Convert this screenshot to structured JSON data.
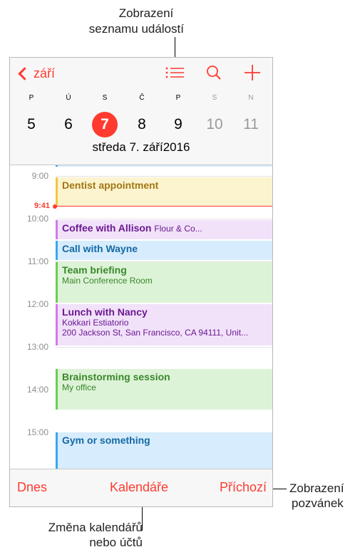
{
  "callouts": {
    "top_line1": "Zobrazení",
    "top_line2": "seznamu událostí",
    "right_line1": "Zobrazení",
    "right_line2": "pozvánek",
    "bottom_line1": "Změna kalendářů",
    "bottom_line2": "nebo účtů"
  },
  "header": {
    "back_label": "září",
    "icons": [
      "list-icon",
      "search-icon",
      "plus-icon"
    ],
    "date_label": "středa 7. září2016"
  },
  "week": {
    "days": [
      {
        "letter": "P",
        "number": "5",
        "weekend": false
      },
      {
        "letter": "Ú",
        "number": "6",
        "weekend": false
      },
      {
        "letter": "S",
        "number": "7",
        "weekend": false,
        "today": true
      },
      {
        "letter": "Č",
        "number": "8",
        "weekend": false
      },
      {
        "letter": "P",
        "number": "9",
        "weekend": false
      },
      {
        "letter": "S",
        "number": "10",
        "weekend": true
      },
      {
        "letter": "N",
        "number": "11",
        "weekend": true
      }
    ]
  },
  "timeline": {
    "hours": [
      "9:00",
      "10:00",
      "11:00",
      "12:00",
      "13:00",
      "14:00",
      "15:00"
    ],
    "now": "9:41"
  },
  "events": [
    {
      "title": "Dentist appointment",
      "color": "yellow"
    },
    {
      "title": "Coffee with Allison",
      "inline": "Flour & Co...",
      "color": "purple"
    },
    {
      "title": "Call with Wayne",
      "color": "blue"
    },
    {
      "title": "Team briefing",
      "sub1": "Main Conference Room",
      "color": "green"
    },
    {
      "title": "Lunch with Nancy",
      "sub1": "Kokkari Estiatorio",
      "sub2": "200 Jackson St, San Francisco, CA  94111, Unit...",
      "color": "purple"
    },
    {
      "title": "Brainstorming session",
      "sub1": "My office",
      "color": "green"
    },
    {
      "title": "Gym or something",
      "color": "blue"
    }
  ],
  "toolbar": {
    "today": "Dnes",
    "calendars": "Kalendáře",
    "inbox": "Příchozí"
  },
  "colors": {
    "accent": "#ff3b30",
    "yellow": "#f4c542",
    "purple": "#cf7ae9",
    "blue": "#3aa6f0",
    "green": "#6ccc55"
  }
}
